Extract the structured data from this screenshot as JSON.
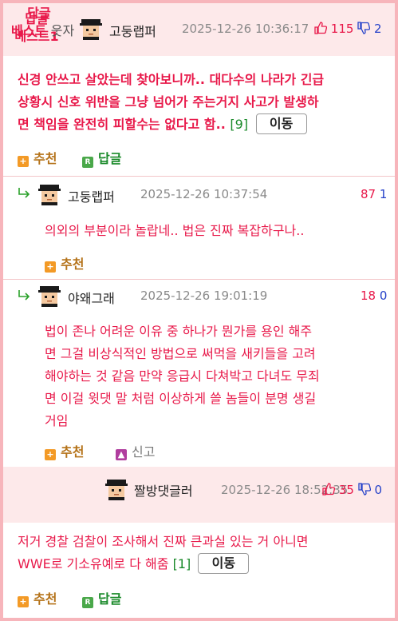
{
  "best1": {
    "badge_line1": "답글",
    "badge_line2": "베스트1",
    "nickname": "고둥랩퍼",
    "time": "2025-12-26 10:36:17",
    "up": "115",
    "down": "2",
    "body_lines": [
      "신경 안쓰고 살았는데 찾아보니까.. 대다수의 나라가 긴급",
      "상황시 신호 위반을 그냥 넘어가 주는거지 사고가 발생하",
      "면 책임을 완전히 피할수는 없다고 함.."
    ],
    "reply_count": "[9]",
    "move_label": "이동",
    "recommend_label": "추천",
    "reply_label": "답글"
  },
  "replies": [
    {
      "nickname": "고둥랩퍼",
      "time": "2025-12-26 10:37:54",
      "up": "87",
      "down": "1",
      "body_lines": [
        "의외의 부분이라 놀랍네.. 법은 진짜 복잡하구나.."
      ],
      "recommend_label": "추천"
    },
    {
      "nickname": "야왜그래",
      "time": "2025-12-26 19:01:19",
      "up": "18",
      "down": "0",
      "body_lines": [
        "법이 존나 어려운 이유 중 하나가 뭔가를 용인 해주",
        "면 그걸 비상식적인 방법으로 써먹을 새키들을 고려",
        "해야하는 것 같음 만약 응급시 다쳐박고 다녀도 무죄",
        "면 이걸 윗댓 말 처럼 이상하게 쓸 놈들이 분명 생길",
        "거임"
      ],
      "recommend_label": "추천",
      "report_label": "신고"
    }
  ],
  "best2": {
    "badge_line1": "답글",
    "badge_line2_a": "베스트",
    "badge_line2_b": "웃자",
    "nickname": "짤방댓글러",
    "time": "2025-12-26 18:52:35",
    "up": "35",
    "down": "0",
    "body_lines": [
      "저거 경찰 검찰이 조사해서 진짜 큰과실 있는 거 아니면",
      "WWE로 기소유예로 다 해줌"
    ],
    "reply_count": "[1]",
    "move_label": "이동",
    "recommend_label": "추천",
    "reply_label": "답글"
  },
  "colors": {
    "accent_red": "#e8194a",
    "down_blue": "#2642c9",
    "count_green": "#1a8a2a",
    "header_pink": "#fde9ea",
    "frame_pink": "#f7b5bb"
  }
}
